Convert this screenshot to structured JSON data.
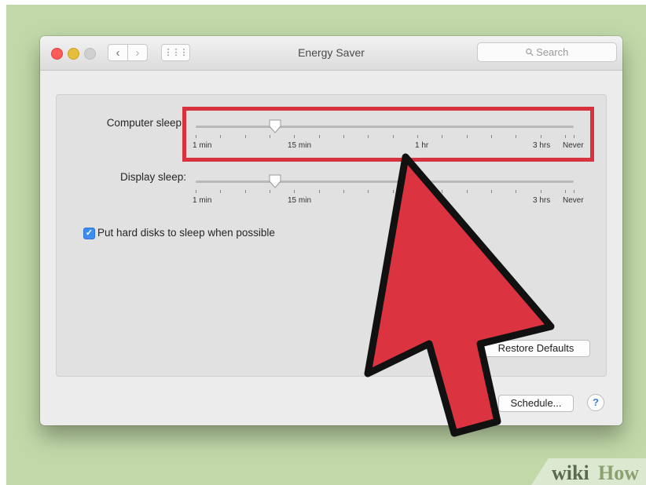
{
  "window": {
    "title": "Energy Saver",
    "search_placeholder": "Search",
    "nav": {
      "back_glyph": "‹",
      "forward_glyph": "›",
      "grid_glyph": "⋮⋮⋮"
    }
  },
  "computer_sleep": {
    "label": "Computer sleep",
    "value": "15 min",
    "ticks": [
      "1 min",
      "15 min",
      "1 hr",
      "3 hrs",
      "Never"
    ]
  },
  "display_sleep": {
    "label": "Display sleep:",
    "value": "15 min",
    "ticks": [
      "1 min",
      "15 min",
      "3 hrs",
      "Never"
    ]
  },
  "hard_disks": {
    "label": "Put hard disks to sleep when possible",
    "checked": true
  },
  "buttons": {
    "restore_defaults": "Restore Defaults",
    "schedule": "Schedule...",
    "help": "?"
  },
  "watermark": {
    "prefix": "wiki",
    "suffix": "How"
  },
  "colors": {
    "background": "#c1d9a9",
    "highlight": "#d8323e",
    "arrow": "#dc3340",
    "checkbox": "#3d8df0"
  }
}
